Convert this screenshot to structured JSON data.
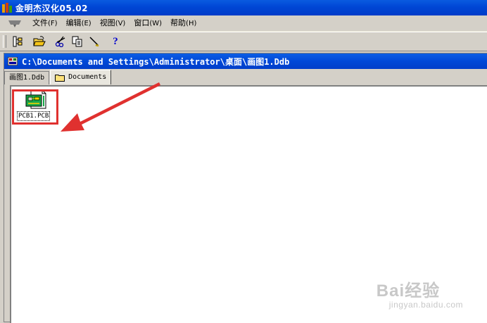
{
  "window": {
    "title": "金明杰汉化05.02"
  },
  "menu": {
    "items": [
      {
        "label": "文件",
        "accel": "(F)"
      },
      {
        "label": "编辑",
        "accel": "(E)"
      },
      {
        "label": "视图",
        "accel": "(V)"
      },
      {
        "label": "窗口",
        "accel": "(W)"
      },
      {
        "label": "帮助",
        "accel": "(H)"
      }
    ]
  },
  "toolbar": {
    "buttons": [
      {
        "icon": "explorer-tree-icon"
      },
      {
        "icon": "open-folder-icon"
      },
      {
        "icon": "cut-icon"
      },
      {
        "icon": "copy-icon"
      },
      {
        "icon": "paste-icon"
      },
      {
        "icon": "help-icon",
        "label": "?"
      }
    ]
  },
  "document": {
    "path": "C:\\Documents and Settings\\Administrator\\桌面\\画图1.Ddb",
    "tabs": [
      {
        "label": "画图1.Ddb",
        "active": false
      },
      {
        "label": "Documents",
        "active": true
      }
    ],
    "files": [
      {
        "name": "PCB1.PCB",
        "icon": "pcb-file-icon"
      }
    ]
  },
  "annotation": {
    "color": "#e0312f"
  },
  "watermark": {
    "top": "Bai经验",
    "bottom": "jingyan.baidu.com"
  }
}
